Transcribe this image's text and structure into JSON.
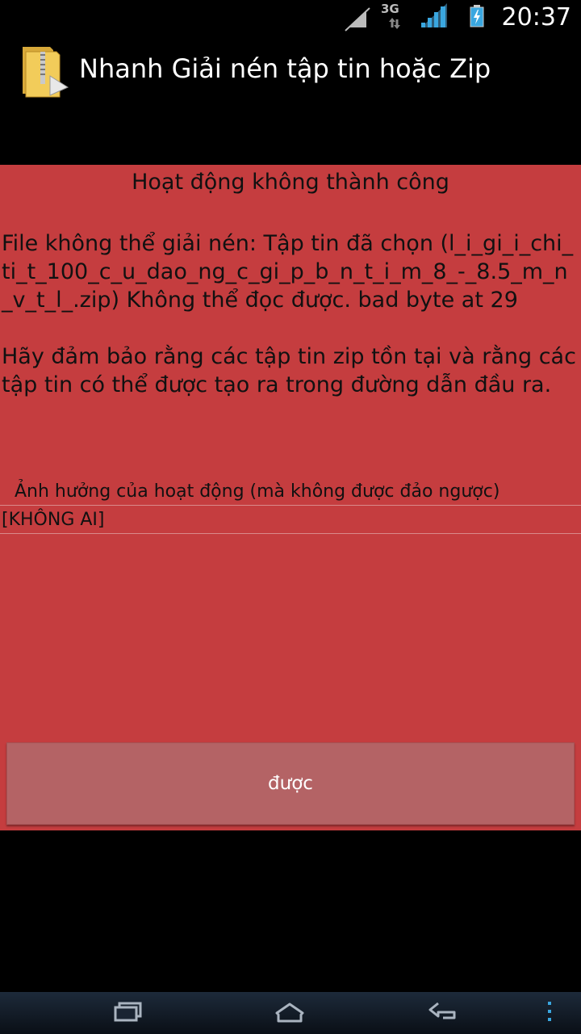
{
  "status_bar": {
    "time": "20:37",
    "network_label": "3G",
    "icons": [
      "signal-muted-icon",
      "network-3g-icon",
      "signal-strength-icon",
      "battery-charging-icon"
    ]
  },
  "app": {
    "title": "Nhanh Giải nén tập tin hoặc Zip",
    "icon": "zip-folder-icon"
  },
  "dialog": {
    "background_color": "#c53d3f",
    "title": "Hoạt động không thành công",
    "message": "File không thể giải nén: Tập tin đã chọn (l_i_gi_i_chi_ti_t_100_c_u_dao_ng_c_gi_p_b_n_t_i_m_8_-_8.5_m_n_v_t_l_.zip) Không thể đọc được. bad byte at 29\n\nHãy đảm bảo rằng các tập tin zip tồn tại và rằng các tập tin có thể được tạo ra trong đường dẫn đầu ra.",
    "effects_label": "Ảnh hưởng của hoạt động (mà không được đảo ngược)",
    "effects_value": "[KHÔNG AI]",
    "ok_label": "được"
  },
  "nav_bar": {
    "icons": [
      "recent-apps-icon",
      "home-icon",
      "back-icon",
      "menu-icon"
    ]
  }
}
